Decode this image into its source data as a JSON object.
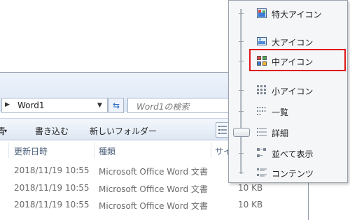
{
  "explorer": {
    "address": {
      "path": "Word1"
    },
    "search": {
      "placeholder": "Word1の検索"
    },
    "toolbar": {
      "partial_left": "青",
      "write_label": "書き込む",
      "new_folder_label": "新しいフォルダー"
    },
    "columns": [
      "更新日時",
      "種類",
      "サイ"
    ],
    "rows": [
      {
        "date": "2018/11/19 10:55",
        "type": "Microsoft Office Word 文書",
        "size": ""
      },
      {
        "date": "2018/11/19 10:55",
        "type": "Microsoft Office Word 文書",
        "size": "10 KB"
      },
      {
        "date": "2018/11/19 10:55",
        "type": "Microsoft Office Word 文書",
        "size": "10 KB"
      }
    ]
  },
  "view_menu": {
    "items": [
      {
        "label": "特大アイコン",
        "icon": "extra-large-icons-icon"
      },
      {
        "label": "大アイコン",
        "icon": "large-icons-icon"
      },
      {
        "label": "中アイコン",
        "icon": "medium-icons-icon"
      },
      {
        "label": "小アイコン",
        "icon": "small-icons-icon"
      },
      {
        "label": "一覧",
        "icon": "list-icon"
      },
      {
        "label": "詳細",
        "icon": "details-icon"
      },
      {
        "label": "並べて表示",
        "icon": "tiles-icon"
      },
      {
        "label": "コンテンツ",
        "icon": "content-icon"
      }
    ],
    "selected": "詳細",
    "highlighted": "中アイコン",
    "highlight_color": "#e01a1a"
  }
}
